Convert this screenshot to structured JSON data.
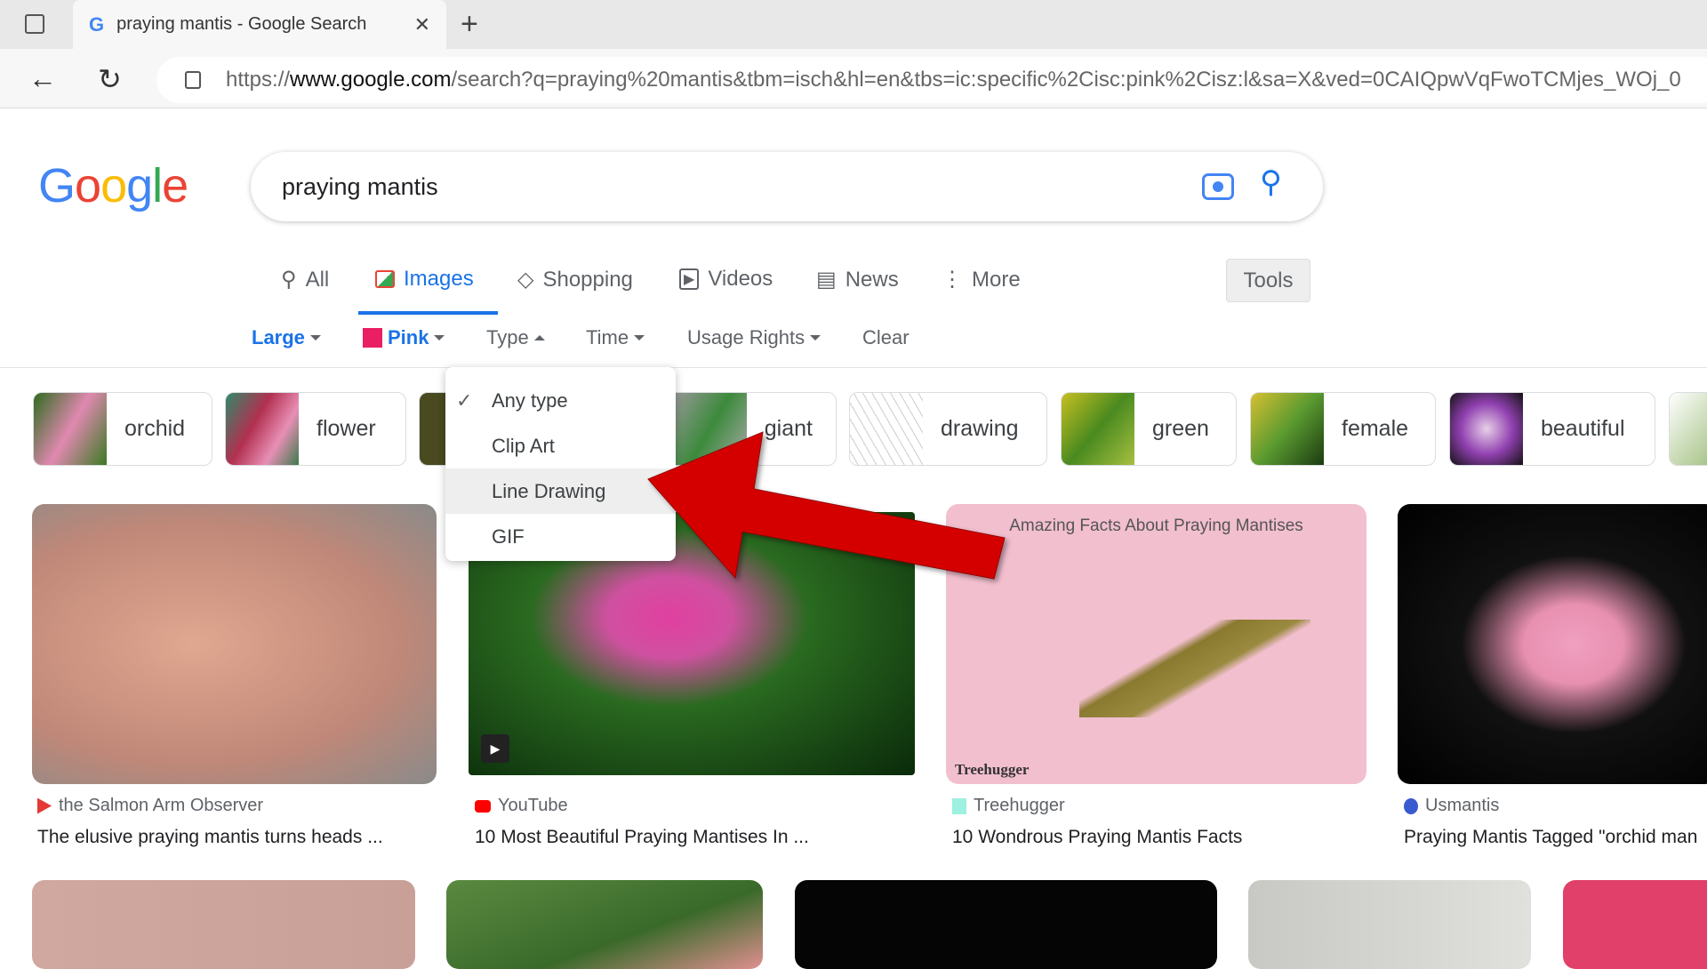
{
  "browser": {
    "tab_title": "praying mantis - Google Search",
    "url_prefix": "https://",
    "url_domain": "www.google.com",
    "url_rest": "/search?q=praying%20mantis&tbm=isch&hl=en&tbs=ic:specific%2Cisc:pink%2Cisz:l&sa=X&ved=0CAIQpwVqFwoTCMjes_WOj_0"
  },
  "logo": "Google",
  "search": {
    "query": "praying mantis"
  },
  "nav": {
    "tabs": [
      {
        "label": "All"
      },
      {
        "label": "Images"
      },
      {
        "label": "Shopping"
      },
      {
        "label": "Videos"
      },
      {
        "label": "News"
      },
      {
        "label": "More"
      }
    ],
    "active": "Images",
    "tools": "Tools"
  },
  "filters": {
    "size": "Large",
    "color": "Pink",
    "color_hex": "#e91e63",
    "type": "Type",
    "time": "Time",
    "usage": "Usage Rights",
    "clear": "Clear"
  },
  "type_menu": {
    "items": [
      "Any type",
      "Clip Art",
      "Line Drawing",
      "GIF"
    ],
    "checked": "Any type",
    "highlighted": "Line Drawing"
  },
  "chips": [
    "orchid",
    "flower",
    "giant",
    "drawing",
    "green",
    "female",
    "beautiful"
  ],
  "results": [
    {
      "source": "the Salmon Arm Observer",
      "title": "The elusive praying mantis turns heads ..."
    },
    {
      "source": "YouTube",
      "title": "10 Most Beautiful Praying Mantises In ..."
    },
    {
      "source": "Treehugger",
      "title": "10 Wondrous Praying Mantis Facts",
      "overlay_title": "Amazing Facts About Praying Mantises",
      "overlay_brand": "Treehugger"
    },
    {
      "source": "Usmantis",
      "title": "Praying Mantis Tagged \"orchid man"
    }
  ],
  "annotation": {
    "arrow_color": "#d40000"
  }
}
